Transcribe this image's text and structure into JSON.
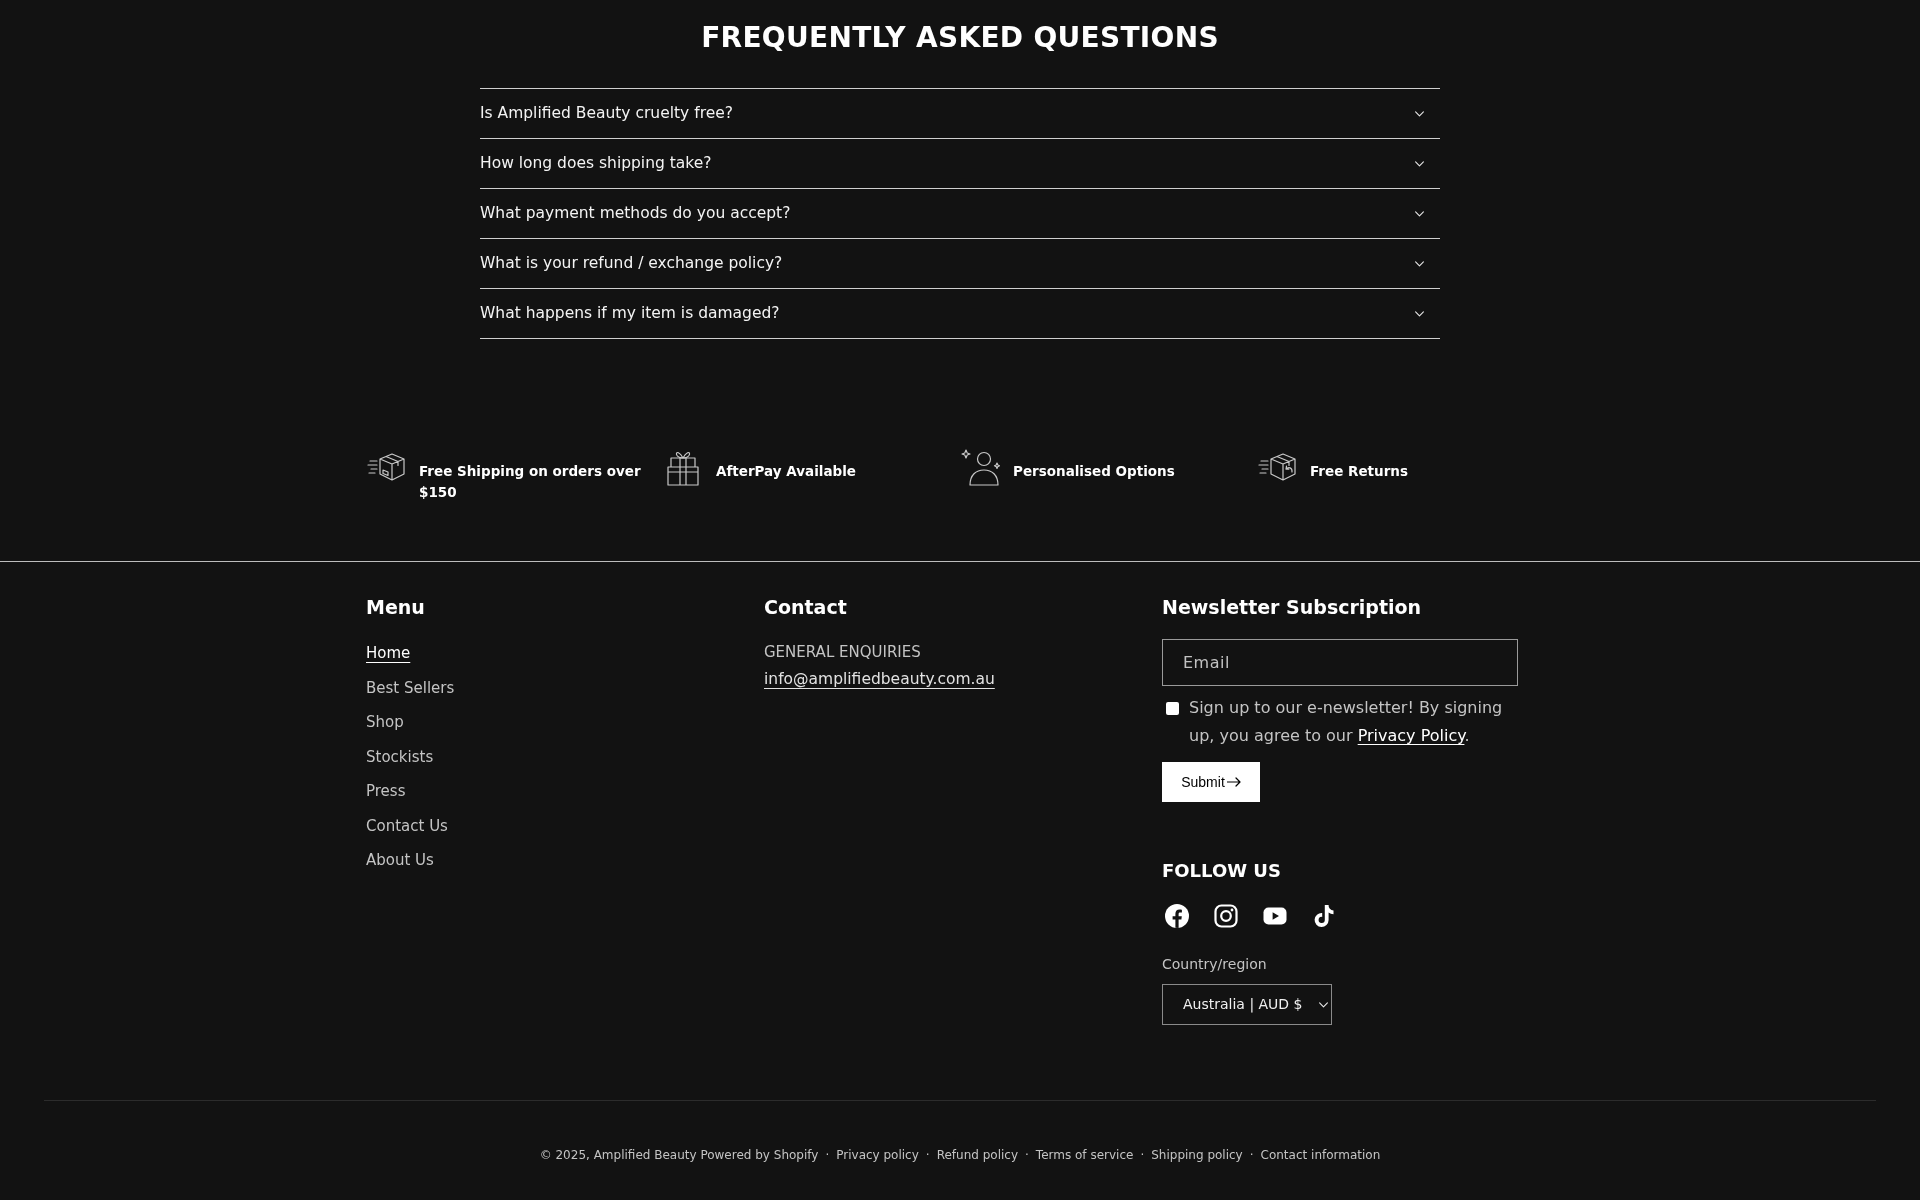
{
  "faq": {
    "title": "FREQUENTLY ASKED QUESTIONS",
    "items": [
      {
        "question": "Is Amplified Beauty cruelty free?",
        "expanded": false
      },
      {
        "question": "How long does shipping take?",
        "expanded": false
      },
      {
        "question": "What payment methods do you accept?",
        "expanded": false
      },
      {
        "question": "What is your refund / exchange policy?",
        "expanded": false
      },
      {
        "question": "What happens if my item is damaged?",
        "expanded": false
      }
    ]
  },
  "features": [
    {
      "kind": "shipping",
      "label": "Free Shipping on orders over $150"
    },
    {
      "kind": "gift",
      "label": "AfterPay Available"
    },
    {
      "kind": "person",
      "label": "Personalised Options"
    },
    {
      "kind": "returns",
      "label": "Free Returns"
    }
  ],
  "footer": {
    "menu": {
      "heading": "Menu",
      "links": [
        {
          "label": "Home",
          "selected": true
        },
        {
          "label": "Best Sellers",
          "selected": false
        },
        {
          "label": "Shop",
          "selected": false
        },
        {
          "label": "Stockists",
          "selected": false
        },
        {
          "label": "Press",
          "selected": false
        },
        {
          "label": "Contact Us",
          "selected": false
        },
        {
          "label": "About Us",
          "selected": false
        }
      ]
    },
    "contact": {
      "heading": "Contact",
      "label": "GENERAL ENQUIRIES",
      "email": "info@amplifiedbeauty.com.au"
    },
    "newsletter": {
      "heading": "Newsletter Subscription",
      "email_field": {
        "placeholder": "Email"
      },
      "consent": {
        "checked": false,
        "text_before": "Sign up to our e-newsletter! By signing up, you agree to our ",
        "link": "Privacy Policy",
        "text_after": "."
      },
      "submit": "Submit"
    },
    "follow_us": {
      "heading": "FOLLOW US",
      "socials": [
        {
          "kind": "facebook"
        },
        {
          "kind": "instagram"
        },
        {
          "kind": "youtube"
        },
        {
          "kind": "tiktok"
        }
      ]
    },
    "country": {
      "label": "Country/region",
      "value": "Australia | AUD $"
    }
  },
  "bottom_bar": {
    "items": [
      {
        "kind": "text",
        "text": "© 2025, Amplified Beauty Powered by Shopify"
      },
      {
        "kind": "separator",
        "text": "·"
      },
      {
        "kind": "link",
        "text": "Privacy policy"
      },
      {
        "kind": "separator",
        "text": "·"
      },
      {
        "kind": "link",
        "text": "Refund policy"
      },
      {
        "kind": "separator",
        "text": "·"
      },
      {
        "kind": "link",
        "text": "Terms of service"
      },
      {
        "kind": "separator",
        "text": "·"
      },
      {
        "kind": "link",
        "text": "Shipping policy"
      },
      {
        "kind": "separator",
        "text": "·"
      },
      {
        "kind": "link",
        "text": "Contact information"
      }
    ]
  }
}
